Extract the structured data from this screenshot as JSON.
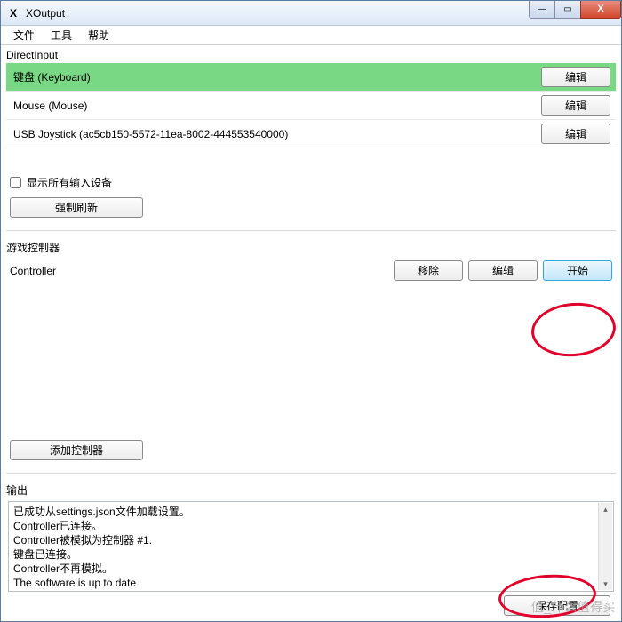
{
  "window": {
    "title": "XOutput"
  },
  "menu": {
    "file": "文件",
    "tools": "工具",
    "help": "帮助"
  },
  "sections": {
    "direct_input": "DirectInput",
    "game_controllers": "游戏控制器",
    "output": "输出"
  },
  "devices": [
    {
      "name": "键盘 (Keyboard)",
      "selected": true
    },
    {
      "name": "Mouse (Mouse)",
      "selected": false
    },
    {
      "name": "USB Joystick      (ac5cb150-5572-11ea-8002-444553540000)",
      "selected": false
    }
  ],
  "buttons": {
    "edit": "编辑",
    "force_refresh": "强制刷新",
    "add_controller": "添加控制器",
    "remove": "移除",
    "start": "开始",
    "save_config": "保存配置"
  },
  "checkbox": {
    "show_all_input_devices": "显示所有输入设备"
  },
  "controller": {
    "name": "Controller"
  },
  "output_log": {
    "l1": "已成功从settings.json文件加载设置。",
    "l2": "Controller已连接。",
    "l3": "Controller被模拟为控制器 #1.",
    "l4": "键盘已连接。",
    "l5": "Controller不再模拟。",
    "l6": "The software is up to date"
  },
  "watermark": "值_什么值得买"
}
